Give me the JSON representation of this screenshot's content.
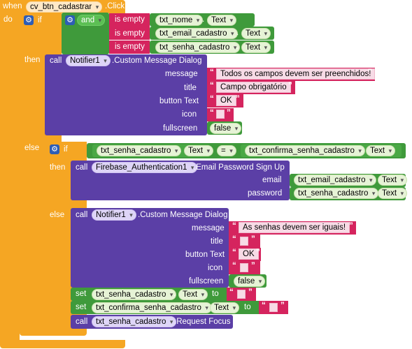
{
  "event": {
    "when": "when",
    "component": "cv_btn_cadastrar",
    "event": ".Click",
    "do": "do"
  },
  "if1": {
    "if": "if",
    "and": "and",
    "is_empty": "is empty",
    "conds": [
      {
        "comp": "txt_nome",
        "prop": "Text"
      },
      {
        "comp": "txt_email_cadastro",
        "prop": "Text"
      },
      {
        "comp": "txt_senha_cadastro",
        "prop": "Text"
      }
    ],
    "then": "then",
    "else": "else"
  },
  "call1": {
    "call": "call",
    "component": "Notifier1",
    "method": ".Custom Message Dialog",
    "params": {
      "message": "message",
      "title": "title",
      "button_text": "button Text",
      "icon": "icon",
      "fullscreen": "fullscreen"
    },
    "values": {
      "message": "Todos os campos devem ser preenchidos!",
      "title": "Campo obrigatório",
      "button_text": "OK",
      "fullscreen": "false"
    }
  },
  "if2": {
    "if": "if",
    "lhs_comp": "txt_senha_cadastro",
    "lhs_prop": "Text",
    "op": "=",
    "rhs_comp": "txt_confirma_senha_cadastro",
    "rhs_prop": "Text",
    "then": "then",
    "else": "else"
  },
  "call2": {
    "call": "call",
    "component": "Firebase_Authentication1",
    "method": ".Email Password Sign Up",
    "params": {
      "email": "email",
      "password": "password"
    },
    "email_comp": "txt_email_cadastro",
    "email_prop": "Text",
    "password_comp": "txt_senha_cadastro",
    "password_prop": "Text"
  },
  "call3": {
    "call": "call",
    "component": "Notifier1",
    "method": ".Custom Message Dialog",
    "params": {
      "message": "message",
      "title": "title",
      "button_text": "button Text",
      "icon": "icon",
      "fullscreen": "fullscreen"
    },
    "values": {
      "message": "As senhas devem ser iguais!",
      "button_text": "OK",
      "fullscreen": "false"
    }
  },
  "set1": {
    "set": "set",
    "comp": "txt_senha_cadastro",
    "prop": "Text",
    "to": "to"
  },
  "set2": {
    "set": "set",
    "comp": "txt_confirma_senha_cadastro",
    "prop": "Text",
    "to": "to"
  },
  "call4": {
    "call": "call",
    "comp": "txt_senha_cadastro",
    "method": ".Request Focus"
  },
  "quote": "“ ”",
  "colors": {
    "event": "#f5a623",
    "procedure": "#5b3fa6",
    "logic": "#3f9a3b",
    "text": "#d5245e"
  }
}
